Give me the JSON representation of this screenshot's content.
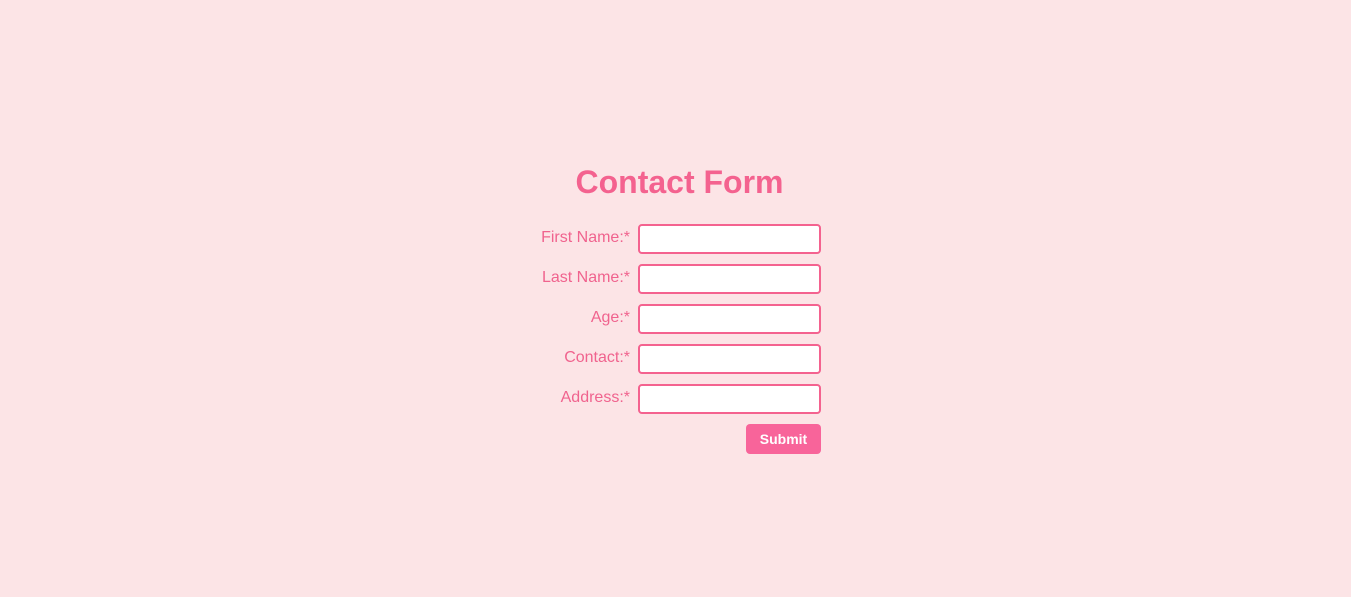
{
  "form": {
    "title": "Contact Form",
    "fields": [
      {
        "label": "First Name:*",
        "value": "",
        "placeholder": ""
      },
      {
        "label": "Last Name:*",
        "value": "",
        "placeholder": ""
      },
      {
        "label": "Age:*",
        "value": "",
        "placeholder": ""
      },
      {
        "label": "Contact:*",
        "value": "",
        "placeholder": ""
      },
      {
        "label": "Address:*",
        "value": "",
        "placeholder": ""
      }
    ],
    "submit_label": "Submit"
  },
  "colors": {
    "background": "#fce4e6",
    "accent": "#f4628f",
    "button": "#f8649a",
    "input_bg": "#ffffff"
  }
}
